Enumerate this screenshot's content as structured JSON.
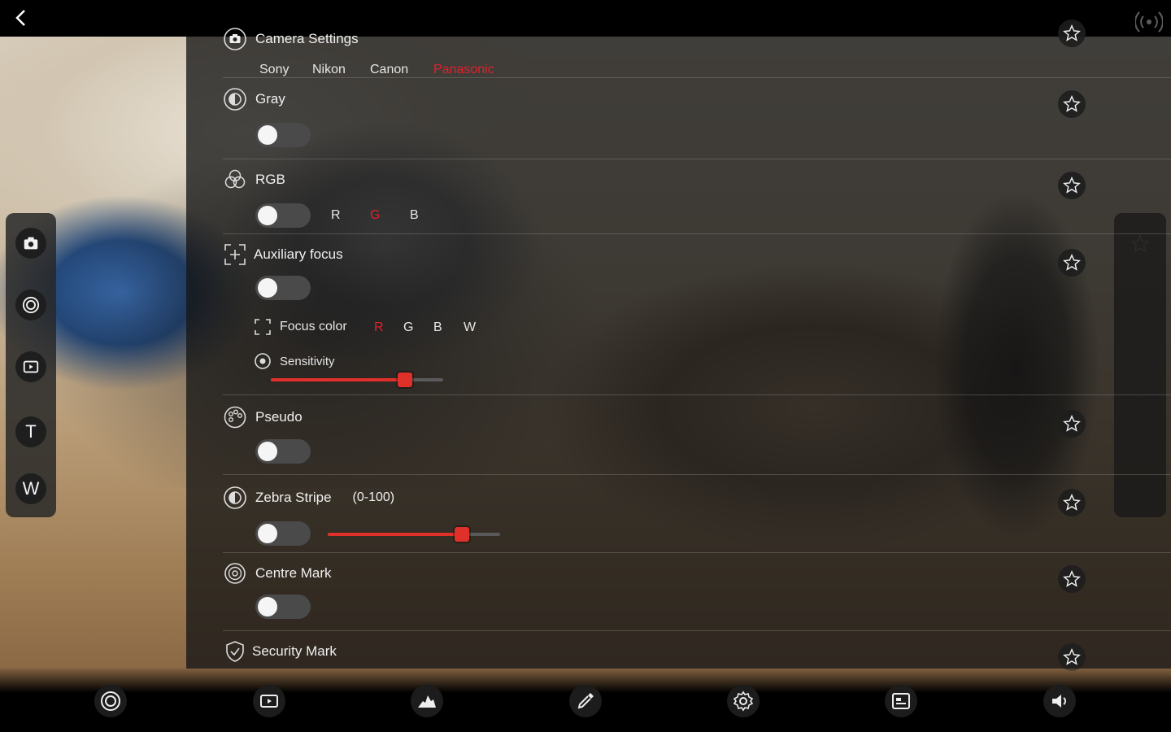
{
  "header": {
    "title": "Camera Settings"
  },
  "brands": {
    "items": [
      "Sony",
      "Nikon",
      "Canon",
      "Panasonic"
    ],
    "selected": "Panasonic"
  },
  "left_strip": {
    "tele_label": "T",
    "wide_label": "W"
  },
  "settings": {
    "gray": {
      "label": "Gray",
      "enabled": false
    },
    "rgb": {
      "label": "RGB",
      "enabled": false,
      "channels": [
        "R",
        "G",
        "B"
      ],
      "selected": "G"
    },
    "aux_focus": {
      "label": "Auxiliary focus",
      "enabled": false,
      "focus_color_label": "Focus color",
      "colors": [
        "R",
        "G",
        "B",
        "W"
      ],
      "selected_color": "R",
      "sensitivity_label": "Sensitivity",
      "sensitivity_fraction": 0.78
    },
    "pseudo": {
      "label": "Pseudo",
      "enabled": false
    },
    "zebra": {
      "label": "Zebra Stripe",
      "range_label": "(0-100)",
      "enabled": false,
      "value": 78
    },
    "centre_mark": {
      "label": "Centre Mark",
      "enabled": false
    },
    "security_mark": {
      "label": "Security Mark"
    }
  },
  "colors": {
    "accent": "#e0202a",
    "panel_bg": "#161616"
  }
}
